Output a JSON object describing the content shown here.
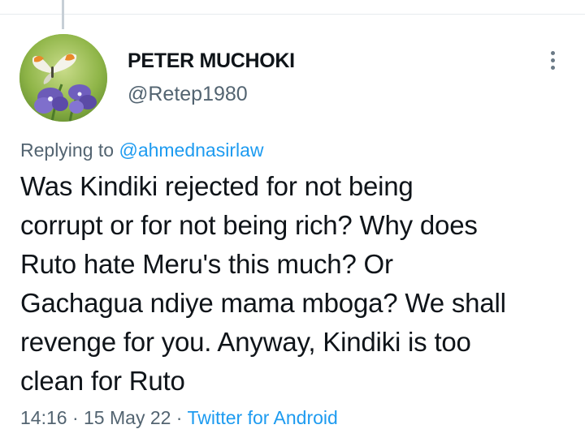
{
  "tweet": {
    "author": {
      "display_name": "PETER MUCHOKI",
      "handle": "@Retep1980",
      "avatar_icon": "avatar-butterfly-flower-photo"
    },
    "more_icon": "more-vertical-icon",
    "reply_context": {
      "prefix": "Replying to ",
      "mention": "@ahmednasirlaw"
    },
    "text": "Was Kindiki rejected for not being\ncorrupt or for not being rich? Why does\nRuto hate Meru's this much? Or\nGachagua ndiye mama mboga? We shall\nrevenge for you. Anyway, Kindiki is too\nclean for Ruto",
    "time": "14:16",
    "separator": " · ",
    "date": "15 May 22",
    "source": "Twitter for Android"
  },
  "colors": {
    "text_primary": "#0f1419",
    "text_secondary": "#536471",
    "link": "#1d9bf0",
    "divider": "#e6ebee"
  }
}
